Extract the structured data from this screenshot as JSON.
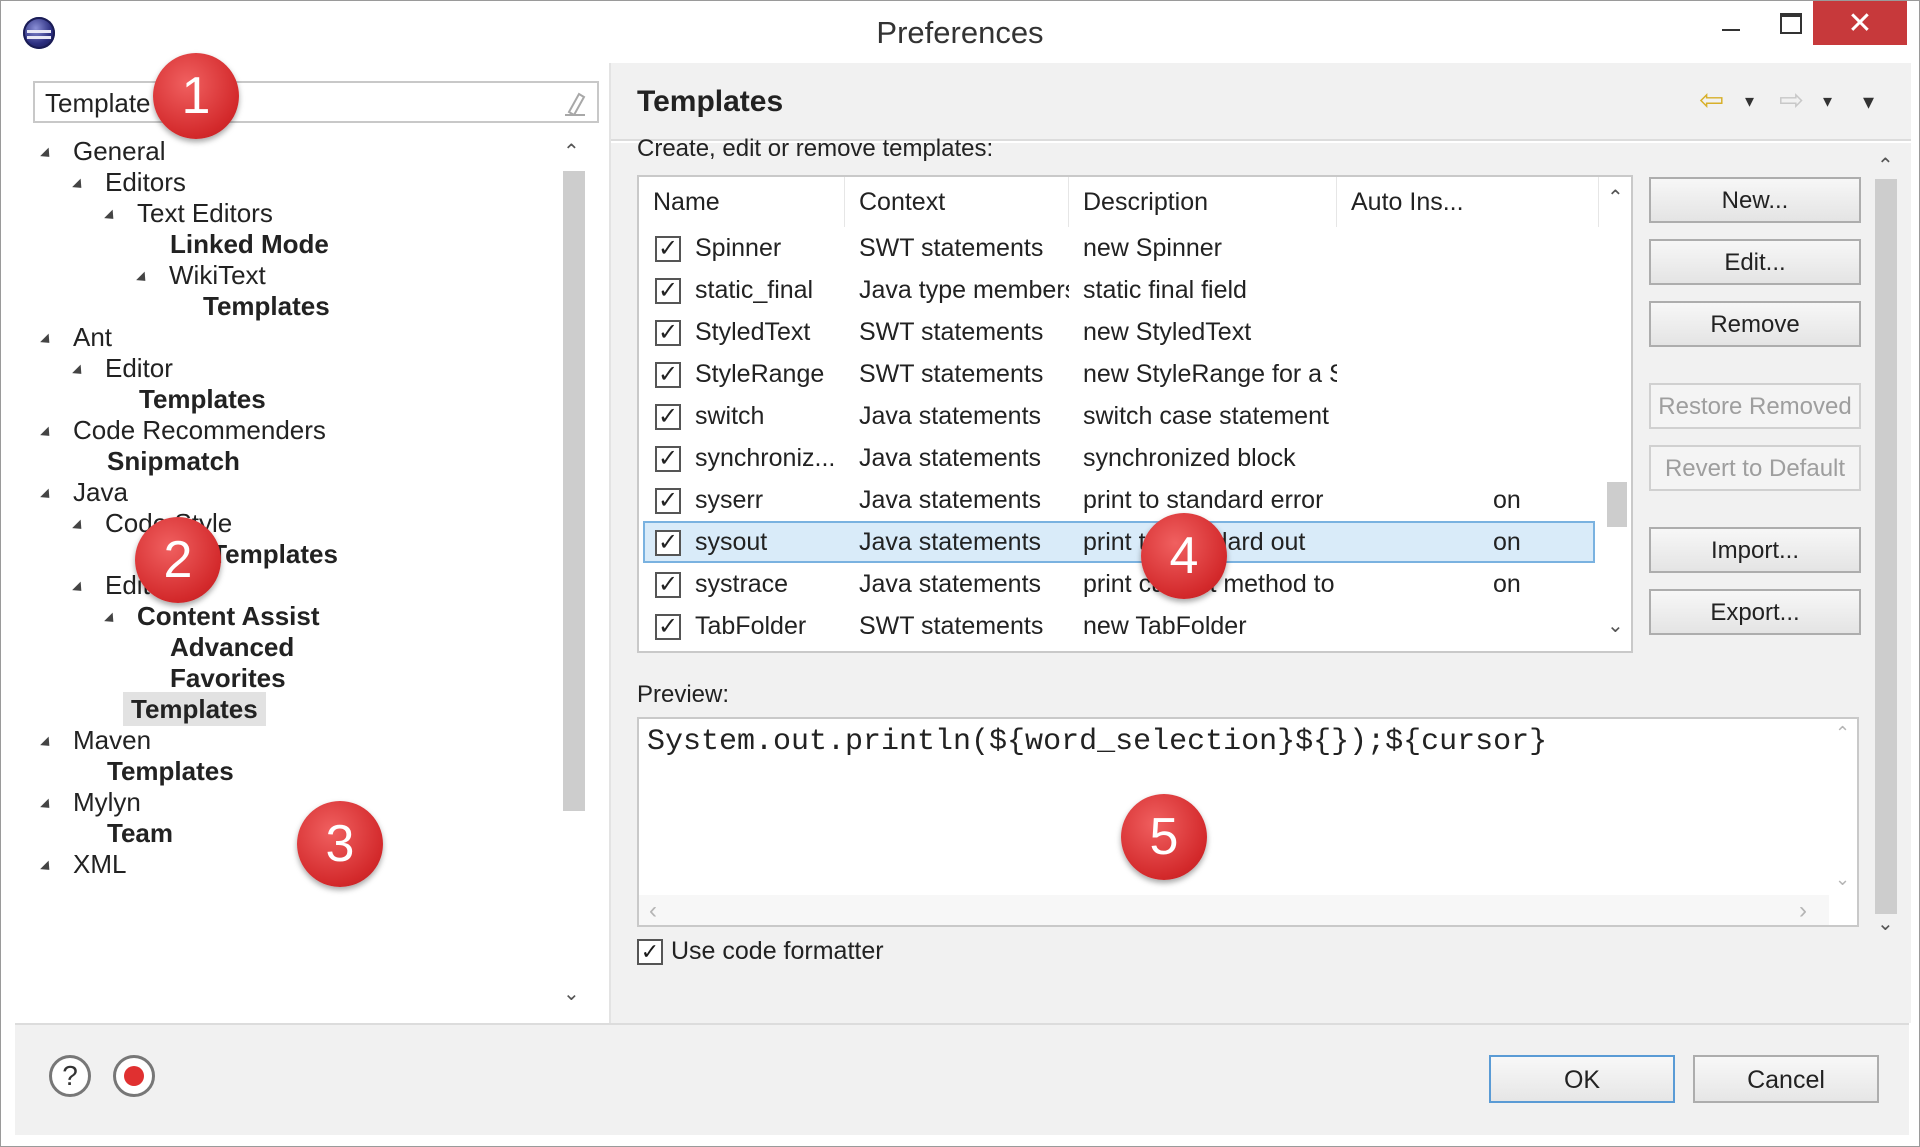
{
  "window": {
    "title": "Preferences",
    "close_glyph": "✕"
  },
  "left": {
    "filter_value": "Template",
    "tree": [
      {
        "label": "General",
        "expanded": true
      },
      {
        "label": "Editors",
        "expanded": true
      },
      {
        "label": "Text Editors",
        "expanded": true
      },
      {
        "label": "Linked Mode"
      },
      {
        "label": "WikiText",
        "expanded": true
      },
      {
        "label": "Templates"
      },
      {
        "label": "Ant",
        "expanded": true
      },
      {
        "label": "Editor",
        "expanded": true
      },
      {
        "label": "Templates"
      },
      {
        "label": "Code Recommenders",
        "expanded": true
      },
      {
        "label": "Snipmatch"
      },
      {
        "label": "Java",
        "expanded": true
      },
      {
        "label": "Code Style",
        "expanded": true
      },
      {
        "label": "Code Templates"
      },
      {
        "label": "Editor",
        "expanded": true
      },
      {
        "label": "Content Assist",
        "expanded": true
      },
      {
        "label": "Advanced"
      },
      {
        "label": "Favorites"
      },
      {
        "label": "Templates",
        "selected": true
      },
      {
        "label": "Maven",
        "expanded": true
      },
      {
        "label": "Templates"
      },
      {
        "label": "Mylyn",
        "expanded": true
      },
      {
        "label": "Team"
      },
      {
        "label": "XML",
        "expanded": true
      }
    ]
  },
  "page": {
    "title": "Templates",
    "intro": "Create, edit or remove templates:",
    "columns": [
      "Name",
      "Context",
      "Description",
      "Auto Ins..."
    ],
    "rows": [
      {
        "name": "Spinner",
        "context": "SWT statements",
        "description": "new Spinner",
        "auto": "",
        "checked": true
      },
      {
        "name": "static_final",
        "context": "Java type members",
        "description": "static final field",
        "auto": "",
        "checked": true
      },
      {
        "name": "StyledText",
        "context": "SWT statements",
        "description": "new StyledText",
        "auto": "",
        "checked": true
      },
      {
        "name": "StyleRange",
        "context": "SWT statements",
        "description": "new StyleRange for a Styl...",
        "auto": "",
        "checked": true
      },
      {
        "name": "switch",
        "context": "Java statements",
        "description": "switch case statement",
        "auto": "",
        "checked": true
      },
      {
        "name": "synchroniz...",
        "context": "Java statements",
        "description": "synchronized block",
        "auto": "",
        "checked": true
      },
      {
        "name": "syserr",
        "context": "Java statements",
        "description": "print to standard error",
        "auto": "on",
        "checked": true
      },
      {
        "name": "sysout",
        "context": "Java statements",
        "description": "print to standard out",
        "auto": "on",
        "checked": true,
        "selected": true
      },
      {
        "name": "systrace",
        "context": "Java statements",
        "description": "print current method to s...",
        "auto": "on",
        "checked": true
      },
      {
        "name": "TabFolder",
        "context": "SWT statements",
        "description": "new TabFolder",
        "auto": "",
        "checked": true
      }
    ],
    "buttons": {
      "new": "New...",
      "edit": "Edit...",
      "remove": "Remove",
      "restore_removed": "Restore Removed",
      "revert_to_default": "Revert to Default",
      "import": "Import...",
      "export": "Export..."
    },
    "preview_label": "Preview:",
    "preview_code": "System.out.println(${word_selection}${});${cursor}",
    "use_code_formatter": {
      "label": "Use code formatter",
      "checked": true
    }
  },
  "footer": {
    "help_glyph": "?",
    "ok": "OK",
    "cancel": "Cancel"
  },
  "callouts": [
    "1",
    "2",
    "3",
    "4",
    "5"
  ],
  "glyphs": {
    "check": "✓",
    "up": "⌃",
    "down": "⌄",
    "back": "⇦",
    "forward": "⇨",
    "caret": "▾",
    "left": "‹",
    "right": "›"
  }
}
